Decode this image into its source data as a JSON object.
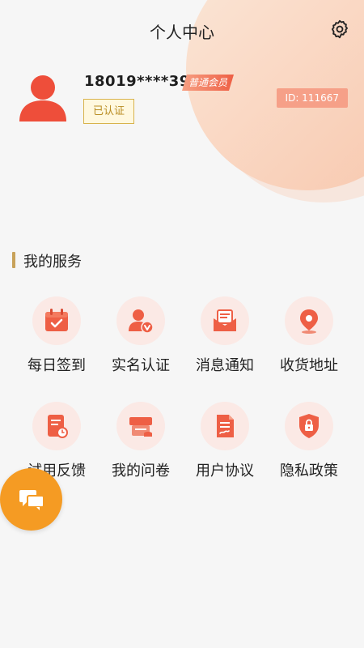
{
  "header": {
    "title": "个人中心"
  },
  "profile": {
    "phone": "18019****39",
    "member_level": "普通会员",
    "verified_label": "已认证",
    "id_label": "ID: 111667"
  },
  "services": {
    "title": "我的服务",
    "items": [
      {
        "label": "每日签到",
        "icon": "calendar-check-icon"
      },
      {
        "label": "实名认证",
        "icon": "user-verify-icon"
      },
      {
        "label": "消息通知",
        "icon": "mail-icon"
      },
      {
        "label": "收货地址",
        "icon": "location-pin-icon"
      },
      {
        "label": "试用反馈",
        "icon": "feedback-doc-icon"
      },
      {
        "label": "我的问卷",
        "icon": "survey-icon"
      },
      {
        "label": "用户协议",
        "icon": "contract-icon"
      },
      {
        "label": "隐私政策",
        "icon": "shield-lock-icon"
      }
    ]
  },
  "colors": {
    "accent": "#ee5f45",
    "icon_bg": "#fbe9e5",
    "float_button": "#f59b23",
    "gold": "#c8a25a"
  }
}
